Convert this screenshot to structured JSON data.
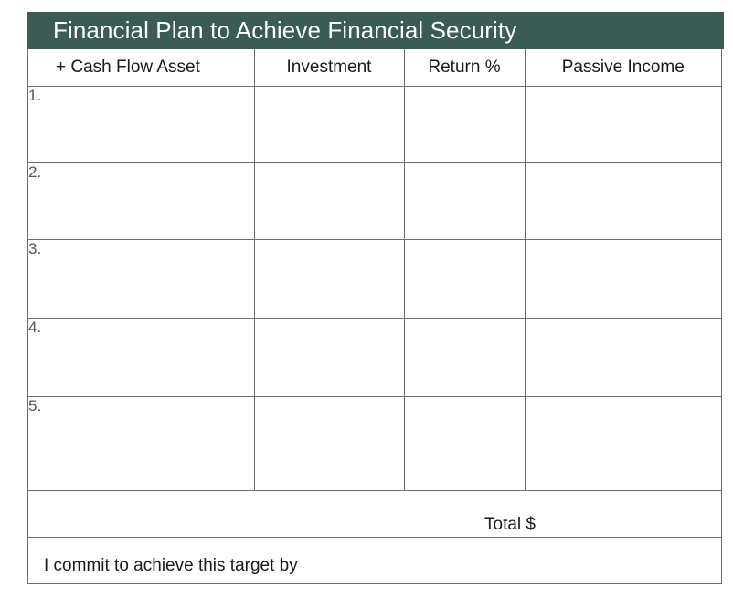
{
  "title": "Financial Plan to Achieve Financial Security",
  "columns": [
    "+ Cash Flow Asset",
    "Investment",
    "Return %",
    "Passive Income"
  ],
  "rows": [
    {
      "number": "1."
    },
    {
      "number": "2."
    },
    {
      "number": "3."
    },
    {
      "number": "4."
    },
    {
      "number": "5."
    }
  ],
  "total_label": "Total $",
  "commit_label": "I commit to achieve this target by",
  "colors": {
    "title_bar": "#3a5c55",
    "grid_lines": "#6f6f6f"
  }
}
